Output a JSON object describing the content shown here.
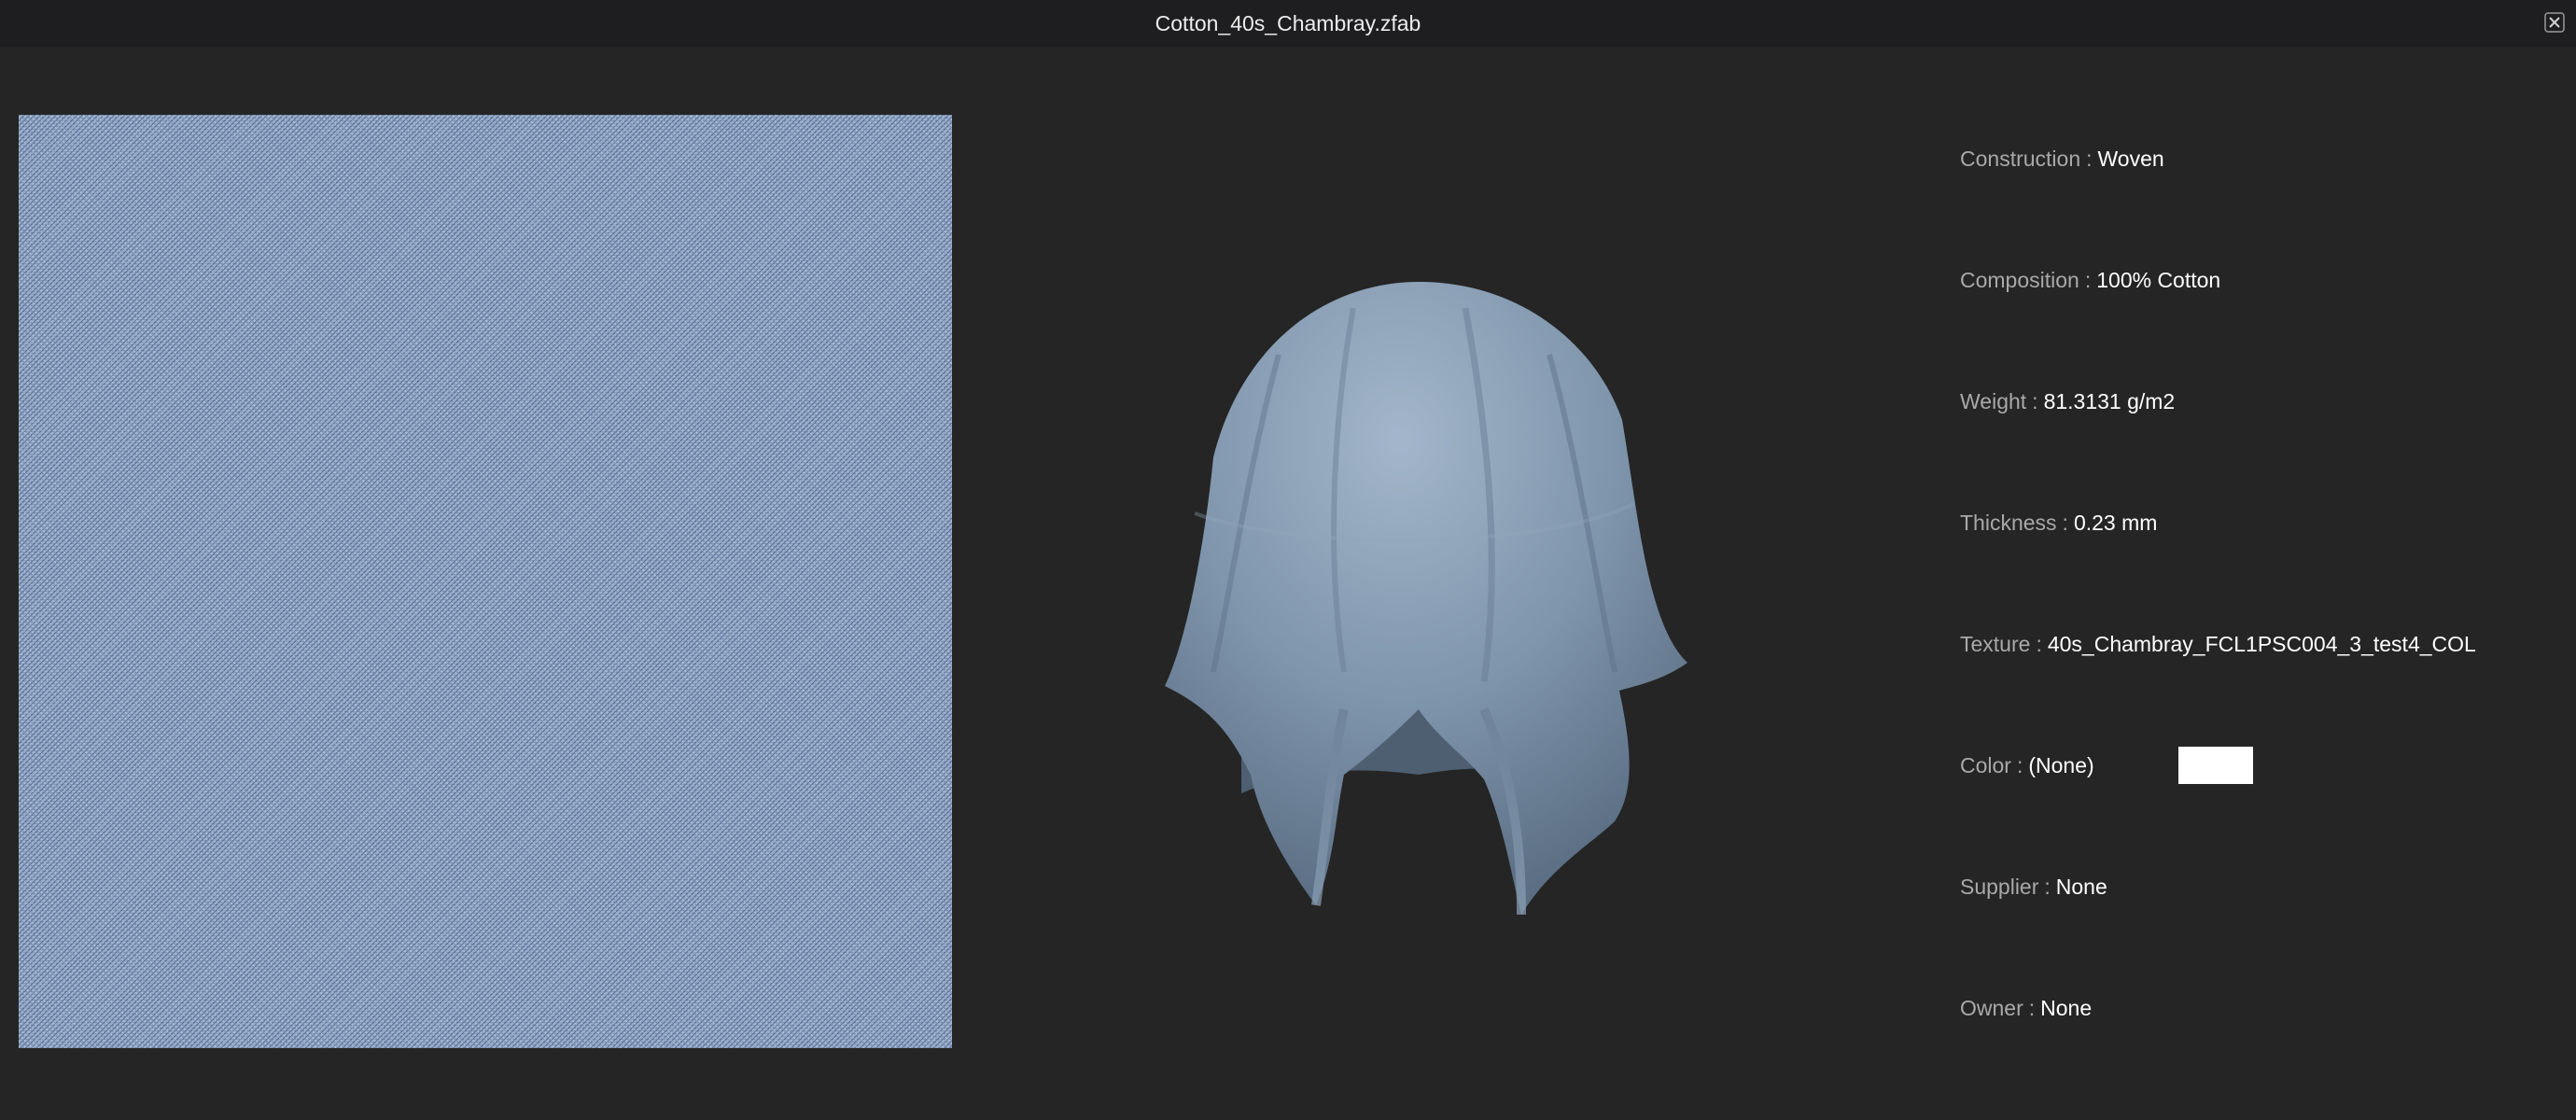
{
  "window": {
    "title": "Cotton_40s_Chambray.zfab",
    "close_icon": "close-icon"
  },
  "swatch": {
    "base_color": "#8fa6c4",
    "thread_color": "#30487a"
  },
  "drape": {
    "fabric_color": "#7f95ac"
  },
  "properties": [
    {
      "label": "Construction",
      "value": "Woven"
    },
    {
      "label": "Composition",
      "value": "100% Cotton"
    },
    {
      "label": "Weight",
      "value": "81.3131 g/m2"
    },
    {
      "label": "Thickness",
      "value": "0.23 mm"
    },
    {
      "label": "Texture",
      "value": "40s_Chambray_FCL1PSC004_3_test4_COL"
    },
    {
      "label": "Color",
      "value": "(None)",
      "swatch_color": "#ffffff"
    },
    {
      "label": "Supplier",
      "value": "None"
    },
    {
      "label": "Owner",
      "value": "None"
    }
  ],
  "separator": ":"
}
